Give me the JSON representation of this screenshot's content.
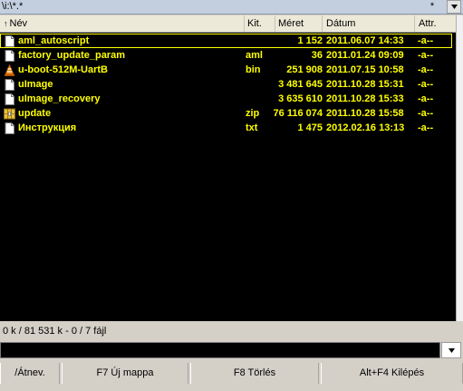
{
  "path_bar": {
    "path": "\\i:\\*.*",
    "filter_label": "*",
    "dropdown_icon": "triangle-down-icon"
  },
  "columns": {
    "name": "Név",
    "ext": "Kit.",
    "size": "Méret",
    "date": "Dátum",
    "attr": "Attr."
  },
  "files": [
    {
      "name": "aml_autoscript",
      "ext": "",
      "size": "1 152",
      "date": "2011.06.07 14:33",
      "attr": "-a--",
      "icon": "file-icon",
      "selected_cursor": true
    },
    {
      "name": "factory_update_param",
      "ext": "aml",
      "size": "36",
      "date": "2011.01.24 09:09",
      "attr": "-a--",
      "icon": "file-icon"
    },
    {
      "name": "u-boot-512M-UartB",
      "ext": "bin",
      "size": "251 908",
      "date": "2011.07.15 10:58",
      "attr": "-a--",
      "icon": "vlc-cone-icon"
    },
    {
      "name": "uImage",
      "ext": "",
      "size": "3 481 645",
      "date": "2011.10.28 15:31",
      "attr": "-a--",
      "icon": "file-icon"
    },
    {
      "name": "uImage_recovery",
      "ext": "",
      "size": "3 635 610",
      "date": "2011.10.28 15:33",
      "attr": "-a--",
      "icon": "file-icon"
    },
    {
      "name": "update",
      "ext": "zip",
      "size": "76 116 074",
      "date": "2011.10.28 15:58",
      "attr": "-a--",
      "icon": "archive-icon"
    },
    {
      "name": "Инструкция",
      "ext": "txt",
      "size": "1 475",
      "date": "2012.02.16 13:13",
      "attr": "-a--",
      "icon": "file-icon"
    }
  ],
  "status": "0 k / 81 531 k - 0 / 7 fájl",
  "fkeys": [
    {
      "label": "/Átnev."
    },
    {
      "label": "F7 Új mappa"
    },
    {
      "label": "F8 Törlés"
    },
    {
      "label": "Alt+F4 Kilépés"
    }
  ],
  "colors": {
    "panel_bg": "#000000",
    "file_text": "#ffff00"
  }
}
